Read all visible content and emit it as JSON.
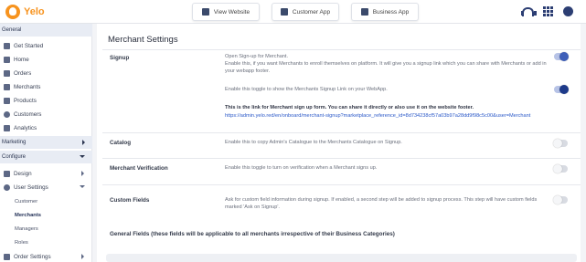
{
  "brand": {
    "name": "Yelo"
  },
  "top_buttons": {
    "view_website": "View Website",
    "customer_app": "Customer App",
    "business_app": "Business App"
  },
  "sidebar": {
    "general": "General",
    "items": [
      {
        "label": "Get Started",
        "icon": "rocket-icon"
      },
      {
        "label": "Home",
        "icon": "home-icon"
      },
      {
        "label": "Orders",
        "icon": "orders-icon"
      },
      {
        "label": "Merchants",
        "icon": "merchants-icon"
      },
      {
        "label": "Products",
        "icon": "products-icon"
      },
      {
        "label": "Customers",
        "icon": "customers-icon"
      },
      {
        "label": "Analytics",
        "icon": "analytics-icon"
      }
    ],
    "marketing": "Marketing",
    "configure": "Configure",
    "design": "Design",
    "user_settings": "User Settings",
    "sub_items": [
      "Customer",
      "Merchants",
      "Managers",
      "Roles"
    ],
    "order_settings": "Order Settings"
  },
  "main": {
    "title": "Merchant Settings",
    "signup": {
      "label": "Signup",
      "desc1": "Open Sign-up for Merchant.",
      "desc2": "Enable this, if you want Merchants to enroll themselves on platform. It will give you a signup link which you can share with Merchants or add in your webapp footer.",
      "desc3": "Enable this toggle to show the Merchants Signup Link on your WebApp.",
      "link_note": "This is the link for Merchant sign up form. You can share it directly or also use it on the website footer.",
      "link": "https://admin.yelo.red/en/onboard/merchant-signup?marketplace_reference_id=8d734238cf57a03b97a28dd9f98c5c00&user=Merchant"
    },
    "catalog": {
      "label": "Catalog",
      "desc": "Enable this to copy Admin's Catalogue to the Merchants Catalogue on Signup."
    },
    "verification": {
      "label": "Merchant Verification",
      "desc": "Enable this toggle to turn on verification when a Merchant signs up."
    },
    "custom_fields": {
      "label": "Custom Fields",
      "desc": "Ask for custom field information during signup. If enabled, a second step will be added to signup process. This step will have custom fields marked 'Ask on Signup'."
    },
    "general_fields": "General Fields (these fields will be applicable to all merchants irrespective of their Business Categories)"
  },
  "toggles": {
    "signup_open": true,
    "signup_link_webapp": true,
    "catalog": false,
    "verification": false,
    "custom_fields": false
  },
  "colors": {
    "accent": "#1d3a8a",
    "brand": "#f7931e",
    "link": "#2a58c8"
  }
}
